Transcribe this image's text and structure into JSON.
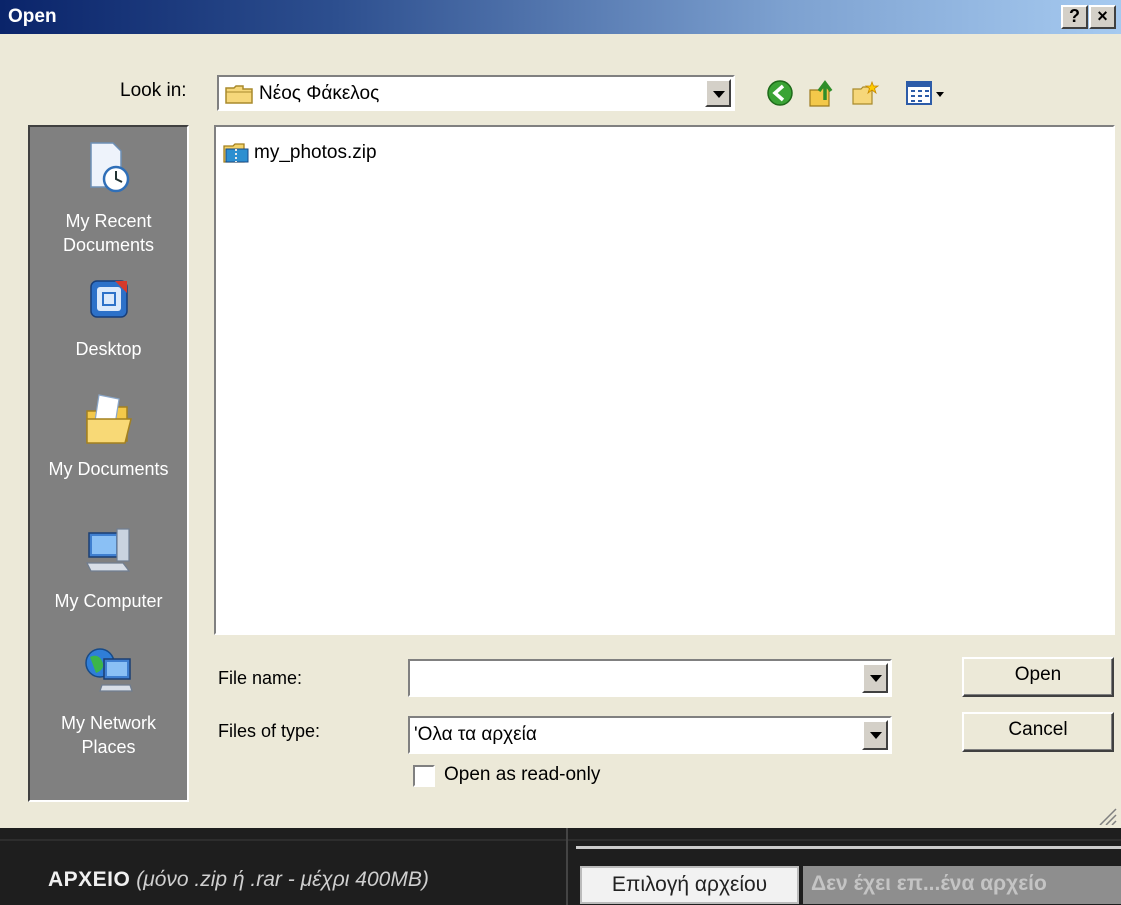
{
  "dialog": {
    "title": "Open",
    "help_label": "?",
    "close_label": "×",
    "look_in_label": "Look in:",
    "look_in_value": "Νέος Φάκελος"
  },
  "places": [
    {
      "label": "My Recent\nDocuments",
      "icon": "recent-documents-icon"
    },
    {
      "label": "Desktop",
      "icon": "desktop-icon"
    },
    {
      "label": "My Documents",
      "icon": "my-documents-icon"
    },
    {
      "label": "My Computer",
      "icon": "my-computer-icon"
    },
    {
      "label": "My Network\nPlaces",
      "icon": "network-places-icon"
    }
  ],
  "files": [
    {
      "name": "my_photos.zip",
      "icon": "zip-folder-icon"
    }
  ],
  "form": {
    "file_name_label": "File name:",
    "file_name_value": "",
    "file_type_label": "Files of type:",
    "file_type_value": "'Ολα τα αρχεία",
    "read_only_label": "Open as read-only",
    "open_button": "Open",
    "cancel_button": "Cancel"
  },
  "webform": {
    "field_label_bold": "ΑΡΧΕΙΟ",
    "field_label_hint": "(μόνο .zip ή .rar - μέχρι 400MB)",
    "choose_button": "Επιλογή αρχείου",
    "no_file_text": "Δεν έχει επ...ένα αρχείο"
  },
  "colors": {
    "dialog_bg": "#ece9d8",
    "places_bg": "#808080",
    "titlebar_start": "#0a246a",
    "titlebar_end": "#a6caf0",
    "webstrip_bg": "#1e1e1e"
  }
}
